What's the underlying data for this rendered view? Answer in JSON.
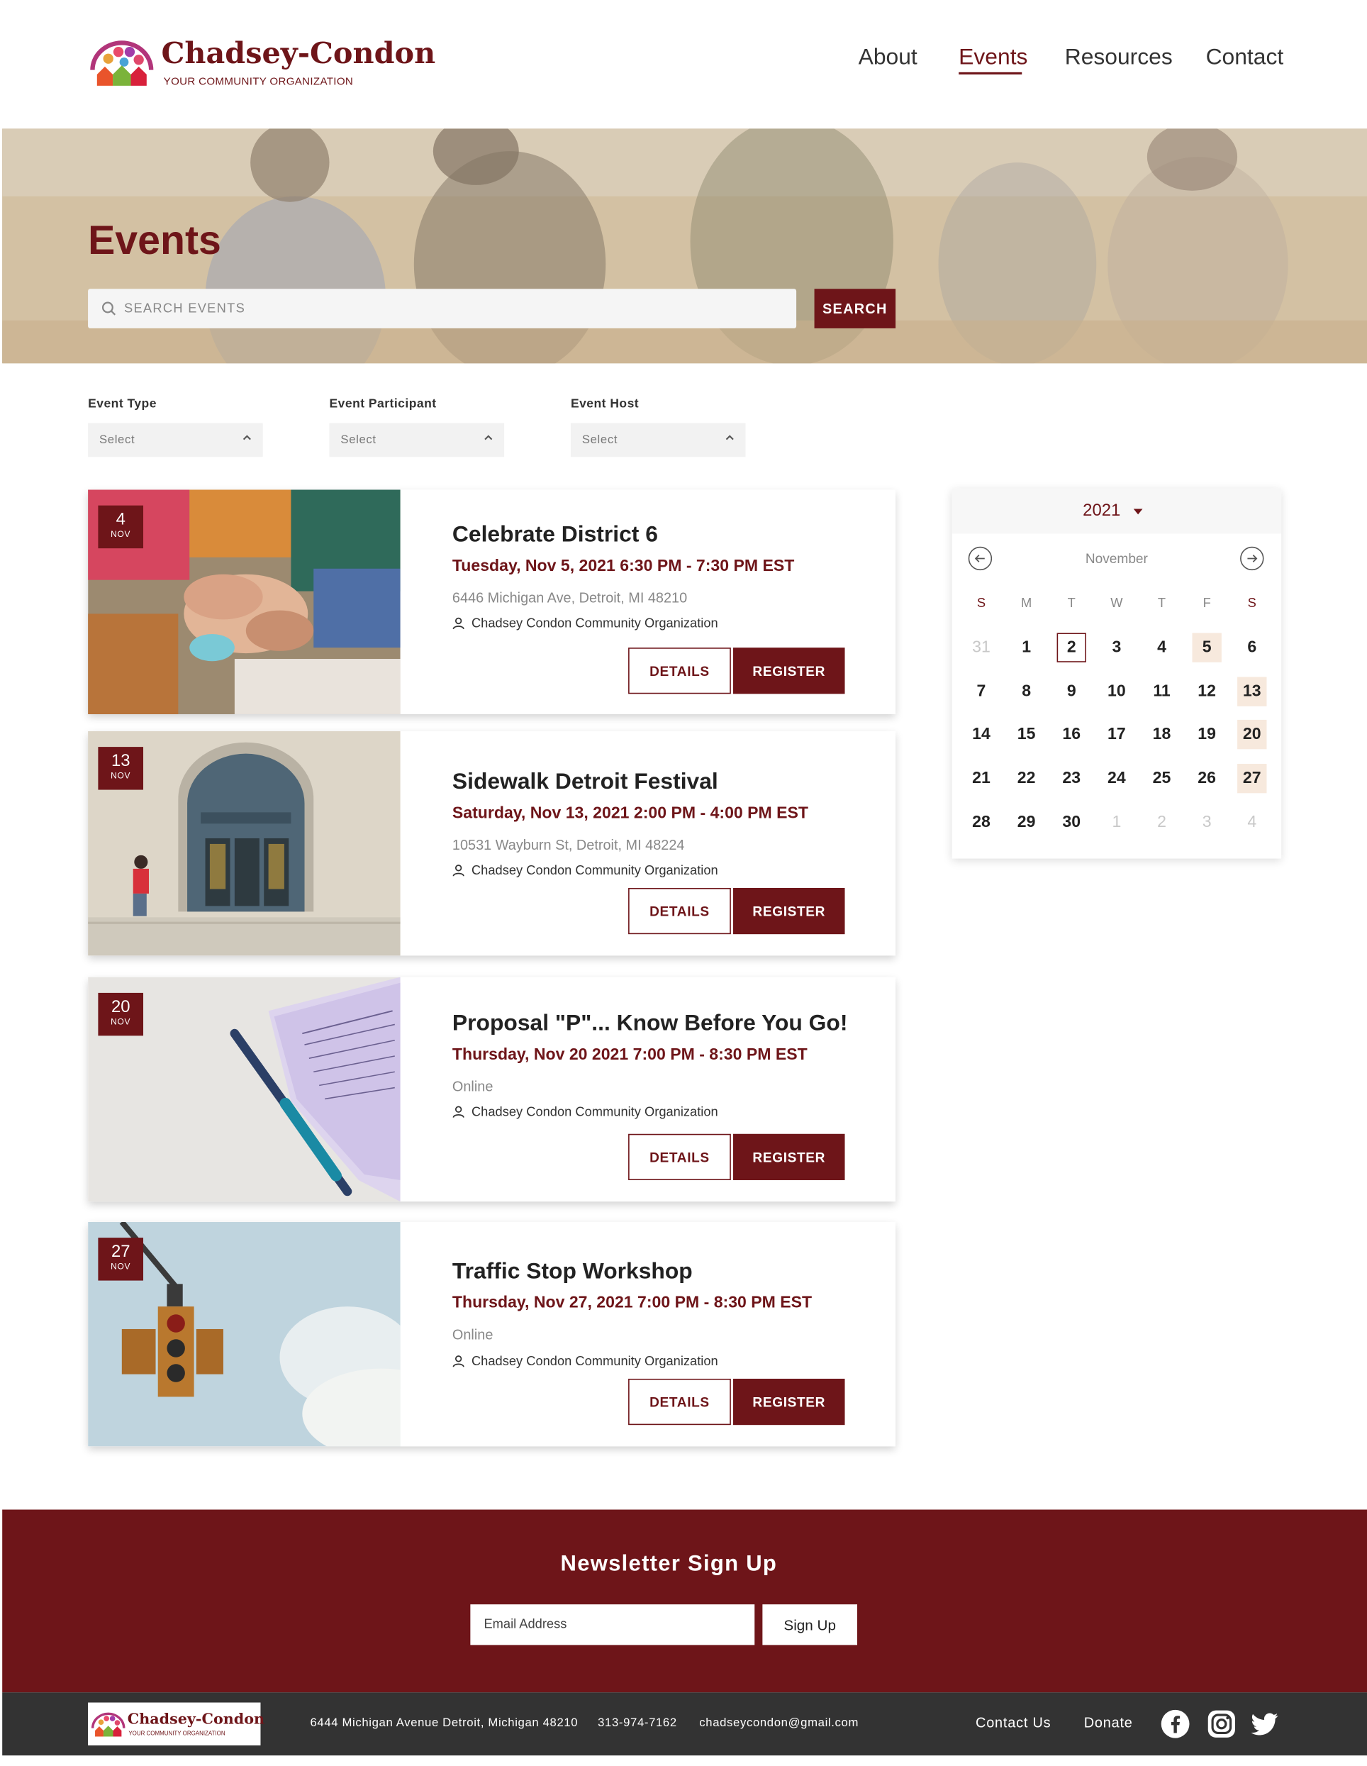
{
  "brand": {
    "name": "Chadsey-Condon",
    "tagline": "YOUR COMMUNITY ORGANIZATION",
    "accent_color": "#6e1519"
  },
  "nav": {
    "items": [
      {
        "label": "About"
      },
      {
        "label": "Events",
        "active": true
      },
      {
        "label": "Resources"
      },
      {
        "label": "Contact"
      }
    ]
  },
  "hero": {
    "title": "Events",
    "search_placeholder": "SEARCH EVENTS",
    "search_button": "SEARCH"
  },
  "filters": [
    {
      "label": "Event Type",
      "value": "Select"
    },
    {
      "label": "Event Participant",
      "value": "Select"
    },
    {
      "label": "Event Host",
      "value": "Select"
    }
  ],
  "events": [
    {
      "day": "4",
      "month": "NOV",
      "title": "Celebrate District 6",
      "when": "Tuesday, Nov 5, 2021 6:30 PM - 7:30 PM EST",
      "location": "6446 Michigan Ave, Detroit, MI 48210",
      "host": "Chadsey Condon Community Organization",
      "details_label": "DETAILS",
      "register_label": "REGISTER"
    },
    {
      "day": "13",
      "month": "NOV",
      "title": "Sidewalk Detroit Festival",
      "when": "Saturday, Nov 13, 2021 2:00 PM - 4:00 PM EST",
      "location": "10531 Wayburn St, Detroit, MI 48224",
      "host": "Chadsey Condon Community Organization",
      "details_label": "DETAILS",
      "register_label": "REGISTER"
    },
    {
      "day": "20",
      "month": "NOV",
      "title": "Proposal \"P\"... Know Before You Go!",
      "when": "Thursday, Nov 20 2021 7:00 PM - 8:30 PM EST",
      "location": "Online",
      "host": "Chadsey Condon Community Organization",
      "details_label": "DETAILS",
      "register_label": "REGISTER"
    },
    {
      "day": "27",
      "month": "NOV",
      "title": "Traffic Stop Workshop",
      "when": "Thursday, Nov 27, 2021 7:00 PM - 8:30 PM EST",
      "location": "Online",
      "host": "Chadsey Condon Community Organization",
      "details_label": "DETAILS",
      "register_label": "REGISTER"
    }
  ],
  "calendar": {
    "year": "2021",
    "month": "November",
    "weekdays": [
      "S",
      "M",
      "T",
      "W",
      "T",
      "F",
      "S"
    ],
    "weeks": [
      [
        "31",
        "1",
        "2",
        "3",
        "4",
        "5",
        "6"
      ],
      [
        "7",
        "8",
        "9",
        "10",
        "11",
        "12",
        "13"
      ],
      [
        "14",
        "15",
        "16",
        "17",
        "18",
        "19",
        "20"
      ],
      [
        "21",
        "22",
        "23",
        "24",
        "25",
        "26",
        "27"
      ],
      [
        "28",
        "29",
        "30",
        "1",
        "2",
        "3",
        "4"
      ]
    ],
    "selected_day": "2",
    "highlighted_days": [
      "5",
      "13",
      "20",
      "27"
    ]
  },
  "newsletter": {
    "title": "Newsletter Sign Up",
    "email_placeholder": "Email Address",
    "button": "Sign Up"
  },
  "footer": {
    "address": "6444 Michigan Avenue Detroit, Michigan 48210",
    "phone": "313-974-7162",
    "email": "chadseycondon@gmail.com",
    "contact_label": "Contact Us",
    "donate_label": "Donate",
    "social": [
      "facebook-icon",
      "instagram-icon",
      "twitter-icon"
    ]
  }
}
